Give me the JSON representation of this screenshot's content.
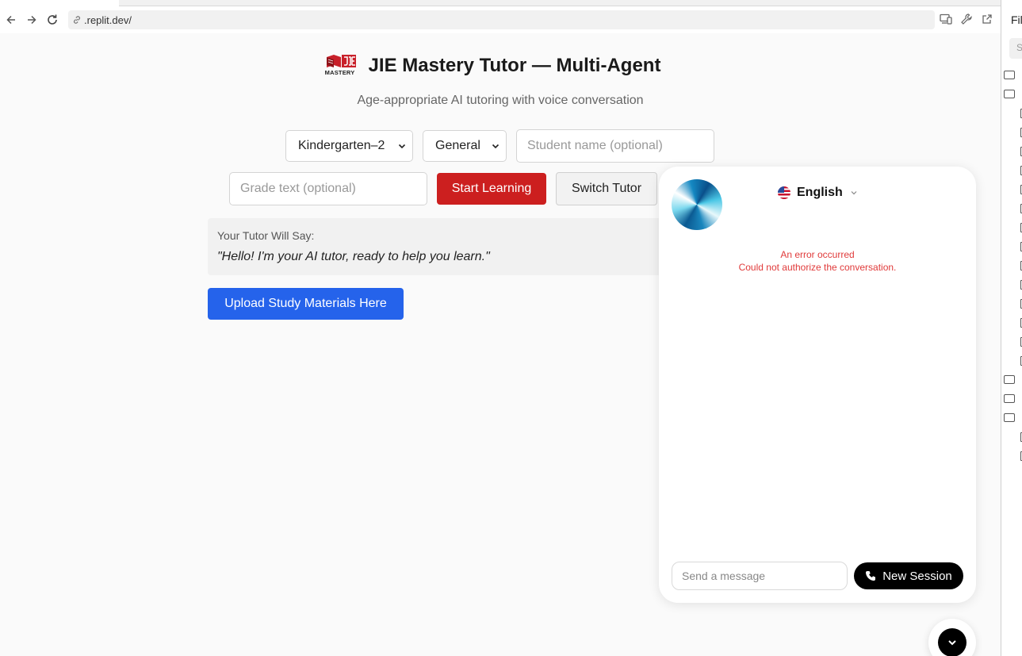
{
  "browser": {
    "url": ".replit.dev/"
  },
  "ide": {
    "files_title": "Files",
    "search_placeholder": "Search"
  },
  "page": {
    "title": "JIE Mastery Tutor — Multi-Agent",
    "logo_text": "MASTERY",
    "subtitle": "Age-appropriate AI tutoring with voice conversation",
    "grade_select": "Kindergarten–2",
    "subject_select": "General",
    "student_name_placeholder": "Student name (optional)",
    "grade_text_placeholder": "Grade text (optional)",
    "start_button": "Start Learning",
    "switch_button": "Switch Tutor",
    "say_label": "Your Tutor Will Say:",
    "say_quote": "\"Hello! I'm your AI tutor, ready to help you learn.\"",
    "upload_button": "Upload Study Materials Here"
  },
  "widget": {
    "language": "English",
    "error_title": "An error occurred",
    "error_detail": "Could not authorize the conversation.",
    "message_placeholder": "Send a message",
    "new_session": "New Session"
  },
  "colors": {
    "start_red": "#cc1f1f",
    "upload_blue": "#2563eb",
    "error_red": "#e03a3a"
  }
}
